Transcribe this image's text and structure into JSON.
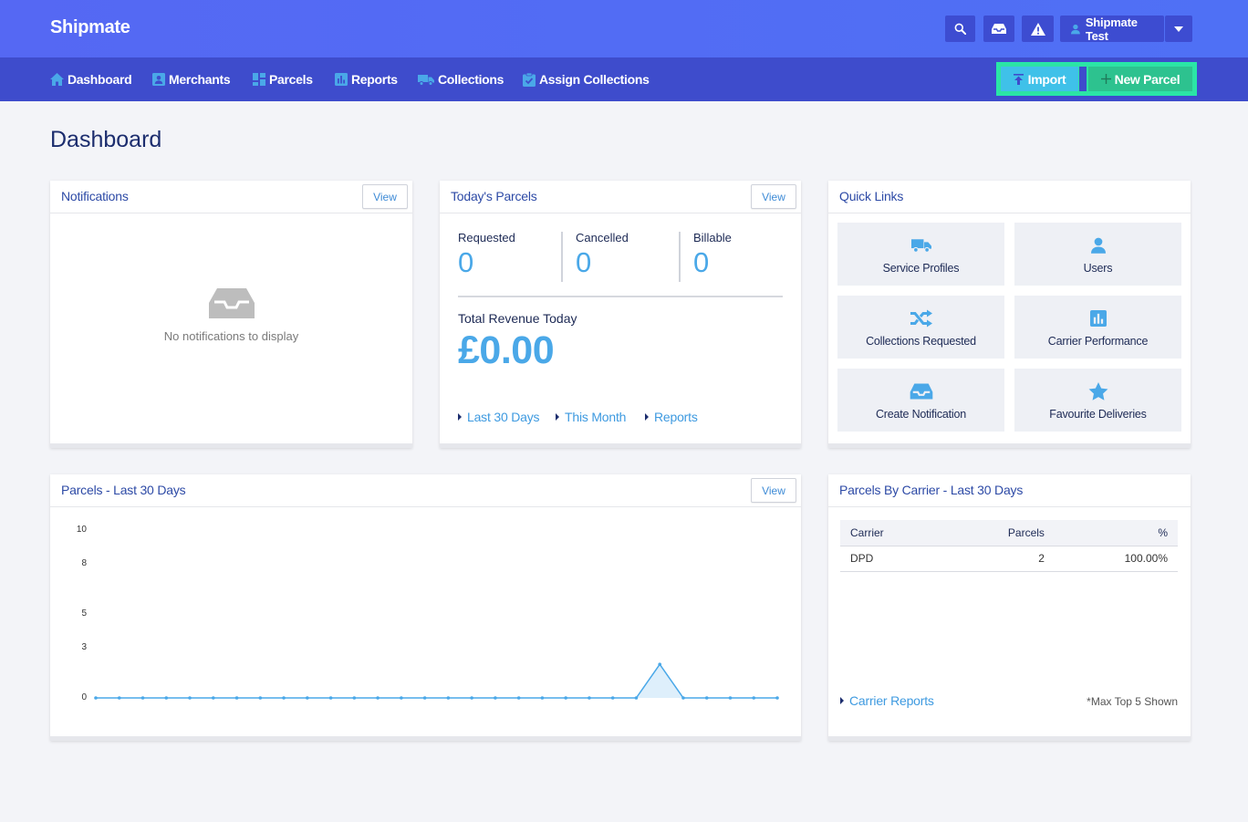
{
  "header": {
    "brand": "Shipmate",
    "user_label": "Shipmate Test",
    "icons": [
      "search-icon",
      "inbox-icon",
      "warning-icon",
      "user-icon",
      "caret-down-icon"
    ]
  },
  "nav": {
    "items": [
      {
        "label": "Dashboard",
        "icon": "home-icon"
      },
      {
        "label": "Merchants",
        "icon": "merchant-icon"
      },
      {
        "label": "Parcels",
        "icon": "grid-icon"
      },
      {
        "label": "Reports",
        "icon": "chart-icon"
      },
      {
        "label": "Collections",
        "icon": "truck-icon"
      },
      {
        "label": "Assign Collections",
        "icon": "clipboard-check-icon"
      }
    ],
    "import_label": "Import",
    "new_parcel_label": "New Parcel"
  },
  "page": {
    "title": "Dashboard"
  },
  "notifications": {
    "title": "Notifications",
    "view_label": "View",
    "empty_text": "No notifications to display"
  },
  "todays_parcels": {
    "title": "Today's Parcels",
    "view_label": "View",
    "stats": [
      {
        "label": "Requested",
        "value": "0"
      },
      {
        "label": "Cancelled",
        "value": "0"
      },
      {
        "label": "Billable",
        "value": "0"
      }
    ],
    "revenue_label": "Total Revenue Today",
    "revenue_value": "£0.00",
    "links": [
      "Last 30 Days",
      "This Month",
      "Reports"
    ]
  },
  "quick_links": {
    "title": "Quick Links",
    "items": [
      {
        "label": "Service Profiles",
        "icon": "truck-icon"
      },
      {
        "label": "Users",
        "icon": "user-icon"
      },
      {
        "label": "Collections Requested",
        "icon": "shuffle-icon"
      },
      {
        "label": "Carrier Performance",
        "icon": "chart-icon"
      },
      {
        "label": "Create Notification",
        "icon": "inbox-icon"
      },
      {
        "label": "Favourite Deliveries",
        "icon": "star-icon"
      }
    ]
  },
  "parcels_chart": {
    "title": "Parcels - Last 30 Days",
    "view_label": "View"
  },
  "chart_data": {
    "type": "area",
    "title": "Parcels - Last 30 Days",
    "xlabel": "",
    "ylabel": "",
    "ylim": [
      0,
      10
    ],
    "y_ticks": [
      "0",
      "3",
      "5",
      "8",
      "10"
    ],
    "x": [
      1,
      2,
      3,
      4,
      5,
      6,
      7,
      8,
      9,
      10,
      11,
      12,
      13,
      14,
      15,
      16,
      17,
      18,
      19,
      20,
      21,
      22,
      23,
      24,
      25,
      26,
      27,
      28,
      29,
      30
    ],
    "series": [
      {
        "values": [
          0,
          0,
          0,
          0,
          0,
          0,
          0,
          0,
          0,
          0,
          0,
          0,
          0,
          0,
          0,
          0,
          0,
          0,
          0,
          0,
          0,
          0,
          0,
          0,
          2,
          0,
          0,
          0,
          0,
          0
        ]
      }
    ],
    "color": "#4aa8e8",
    "grid": false
  },
  "carriers": {
    "title": "Parcels By Carrier - Last 30 Days",
    "columns": [
      "Carrier",
      "Parcels",
      "%"
    ],
    "rows": [
      {
        "carrier": "DPD",
        "parcels": "2",
        "percent": "100.00%"
      }
    ],
    "link_label": "Carrier Reports",
    "note": "*Max Top 5 Shown"
  }
}
